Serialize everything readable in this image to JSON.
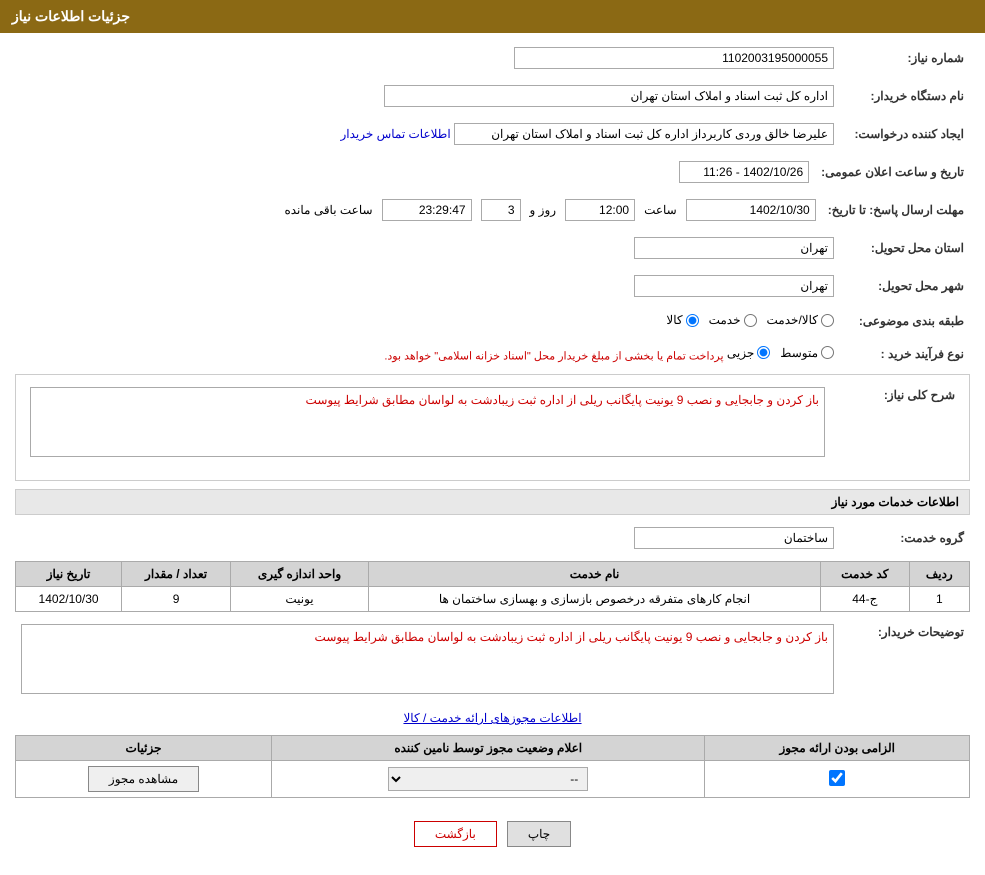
{
  "page": {
    "title": "جزئیات اطلاعات نیاز",
    "header": "جزئیات اطلاعات نیاز"
  },
  "fields": {
    "need_number_label": "شماره نیاز:",
    "need_number_value": "1102003195000055",
    "buyer_org_label": "نام دستگاه خریدار:",
    "buyer_org_value": "اداره کل ثبت اسناد و املاک استان تهران",
    "creator_label": "ایجاد کننده درخواست:",
    "creator_value": "علیرضا خالق وردی کاربرداز اداره کل ثبت اسناد و املاک استان تهران",
    "contact_link": "اطلاعات تماس خریدار",
    "announce_date_label": "تاریخ و ساعت اعلان عمومی:",
    "announce_date_value": "1402/10/26 - 11:26",
    "response_deadline_label": "مهلت ارسال پاسخ: تا تاریخ:",
    "response_date": "1402/10/30",
    "response_time_label": "ساعت",
    "response_time": "12:00",
    "response_days_label": "روز و",
    "response_days": "3",
    "response_remaining_label": "ساعت باقی مانده",
    "response_remaining": "23:29:47",
    "province_label": "استان محل تحویل:",
    "province_value": "تهران",
    "city_label": "شهر محل تحویل:",
    "city_value": "تهران",
    "category_label": "طبقه بندی موضوعی:",
    "category_kala": "کالا",
    "category_khadamat": "خدمت",
    "category_kala_khadamat": "کالا/خدمت",
    "process_label": "نوع فرآیند خرید :",
    "process_jozvi": "جزیی",
    "process_motavasset": "متوسط",
    "process_note": "پرداخت تمام یا بخشی از مبلغ خریدار محل \"اسناد خزانه اسلامی\" خواهد بود.",
    "need_desc_label": "شرح کلی نیاز:",
    "need_desc_value": "باز کردن و جابجایی و نصب 9 یونیت پایگانب ریلی از اداره ثبت زیبادشت به لواسان مطابق شرایط پیوست",
    "services_section_label": "اطلاعات خدمات مورد نیاز",
    "service_group_label": "گروه خدمت:",
    "service_group_value": "ساختمان",
    "services_table": {
      "headers": [
        "ردیف",
        "کد خدمت",
        "نام خدمت",
        "واحد اندازه گیری",
        "تعداد / مقدار",
        "تاریخ نیاز"
      ],
      "rows": [
        {
          "row": "1",
          "code": "ج-44",
          "name": "انجام کارهای متفرقه درخصوص بازسازی و بهسازی ساختمان ها",
          "unit": "یونیت",
          "quantity": "9",
          "date": "1402/10/30"
        }
      ]
    },
    "buyer_desc_label": "توضیحات خریدار:",
    "buyer_desc_value": "باز کردن و جابجایی و نصب 9 یونیت پایگانب ریلی از اداره ثبت زیبادشت به لواسان مطابق شرایط پیوست",
    "licenses_section_label": "اطلاعات مجوزهای ارائه خدمت / کالا",
    "licenses_table": {
      "headers": [
        "الزامی بودن ارائه مجوز",
        "اعلام وضعیت مجوز توسط نامین کننده",
        "جزئیات"
      ],
      "rows": [
        {
          "required": true,
          "status": "--",
          "details_label": "مشاهده مجوز"
        }
      ]
    },
    "btn_print": "چاپ",
    "btn_back": "بازگشت"
  }
}
